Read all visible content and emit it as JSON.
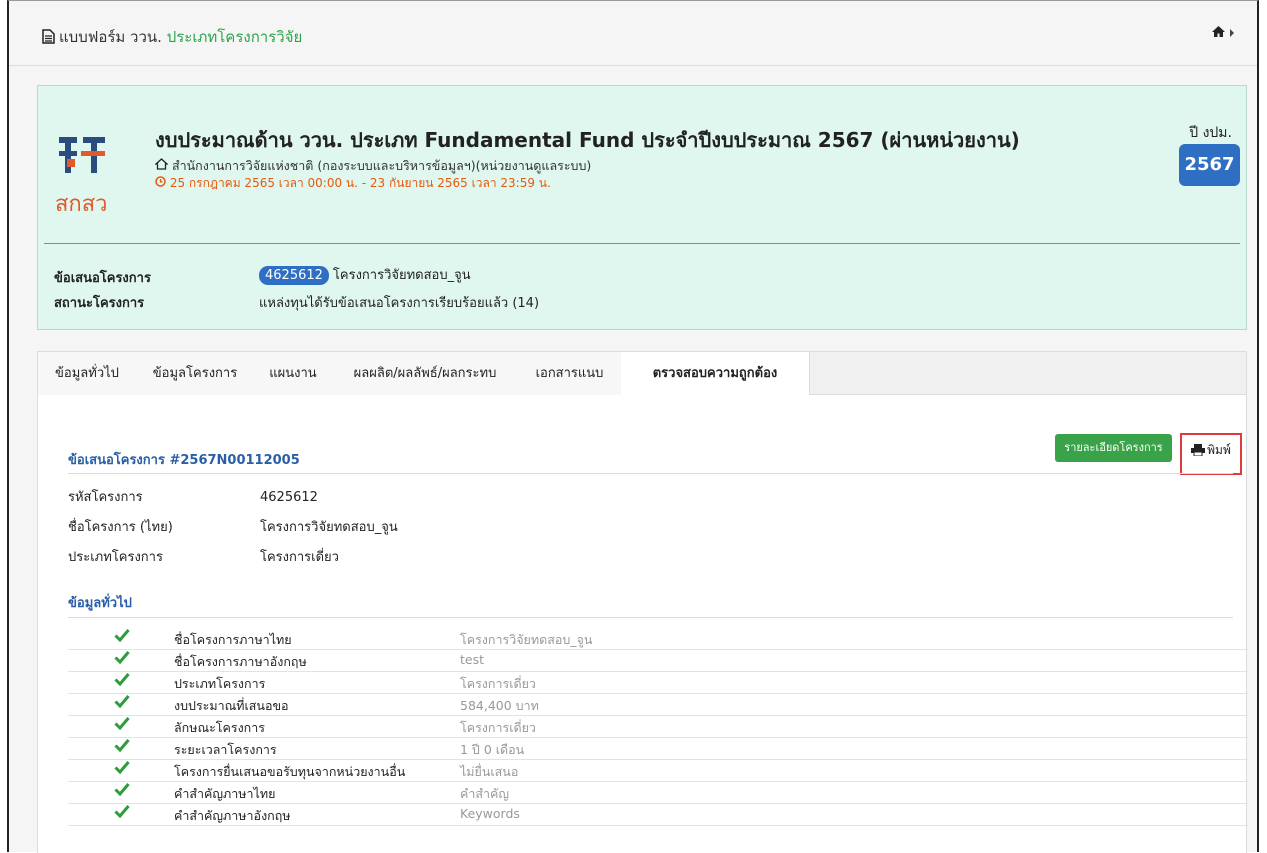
{
  "header": {
    "form_label": "แบบฟอร์ม ววน.",
    "form_type": "ประเภทโครงการวิจัย"
  },
  "summary": {
    "logo_text": "สกสว",
    "title": "งบประมาณด้าน ววน. ประเภท Fundamental Fund ประจำปีงบประมาณ 2567 (ผ่านหน่วยงาน)",
    "org": "สำนักงานการวิจัยแห่งชาติ (กองระบบและบริหารข้อมูลฯ)(หน่วยงานดูแลระบบ)",
    "period": "25 กรกฎาคม 2565 เวลา 00:00 น. - 23 กันยายน 2565 เวลา 23:59 น.",
    "year_label": "ปี งปม.",
    "year": "2567",
    "proposal_label": "ข้อเสนอโครงการ",
    "proposal_id": "4625612",
    "proposal_name": "โครงการวิจัยทดสอบ_จูน",
    "status_label": "สถานะโครงการ",
    "status_value": "แหล่งทุนได้รับข้อเสนอโครงการเรียบร้อยแล้ว (14)"
  },
  "tabs": [
    {
      "label": "ข้อมูลทั่วไป"
    },
    {
      "label": "ข้อมูลโครงการ"
    },
    {
      "label": "แผนงาน"
    },
    {
      "label": "ผลผลิต/ผลลัพธ์/ผลกระทบ"
    },
    {
      "label": "เอกสารแนบ"
    },
    {
      "label": "ตรวจสอบความถูกต้อง"
    }
  ],
  "content": {
    "section_title": "ข้อเสนอโครงการ #2567N00112005",
    "detail_button": "รายละเอียดโครงการ",
    "print_button": "พิมพ์",
    "meta": [
      {
        "k": "รหัสโครงการ",
        "v": "4625612"
      },
      {
        "k": "ชื่อโครงการ (ไทย)",
        "v": "โครงการวิจัยทดสอบ_จูน"
      },
      {
        "k": "ประเภทโครงการ",
        "v": "โครงการเดี่ยว"
      }
    ],
    "general_title": "ข้อมูลทั่วไป",
    "checks": [
      {
        "label": "ชื่อโครงการภาษาไทย",
        "value": "โครงการวิจัยทดสอบ_จูน"
      },
      {
        "label": "ชื่อโครงการภาษาอังกฤษ",
        "value": "test"
      },
      {
        "label": "ประเภทโครงการ",
        "value": "โครงการเดี่ยว"
      },
      {
        "label": "งบประมาณที่เสนอขอ",
        "value": "584,400 บาท"
      },
      {
        "label": "ลักษณะโครงการ",
        "value": "โครงการเดี่ยว"
      },
      {
        "label": "ระยะเวลาโครงการ",
        "value": "1 ปี 0 เดือน"
      },
      {
        "label": "โครงการยื่นเสนอขอรับทุนจากหน่วยงานอื่น",
        "value": "ไม่ยื่นเสนอ"
      },
      {
        "label": "คำสำคัญภาษาไทย",
        "value": "คำสำคัญ"
      },
      {
        "label": "คำสำคัญภาษาอังกฤษ",
        "value": "Keywords"
      }
    ]
  },
  "colors": {
    "accent_blue": "#2f6fc3",
    "accent_green": "#3aa34a",
    "panel_bg": "#dff7ef",
    "period_orange": "#e8590c",
    "highlight_red": "#e03b3b"
  }
}
